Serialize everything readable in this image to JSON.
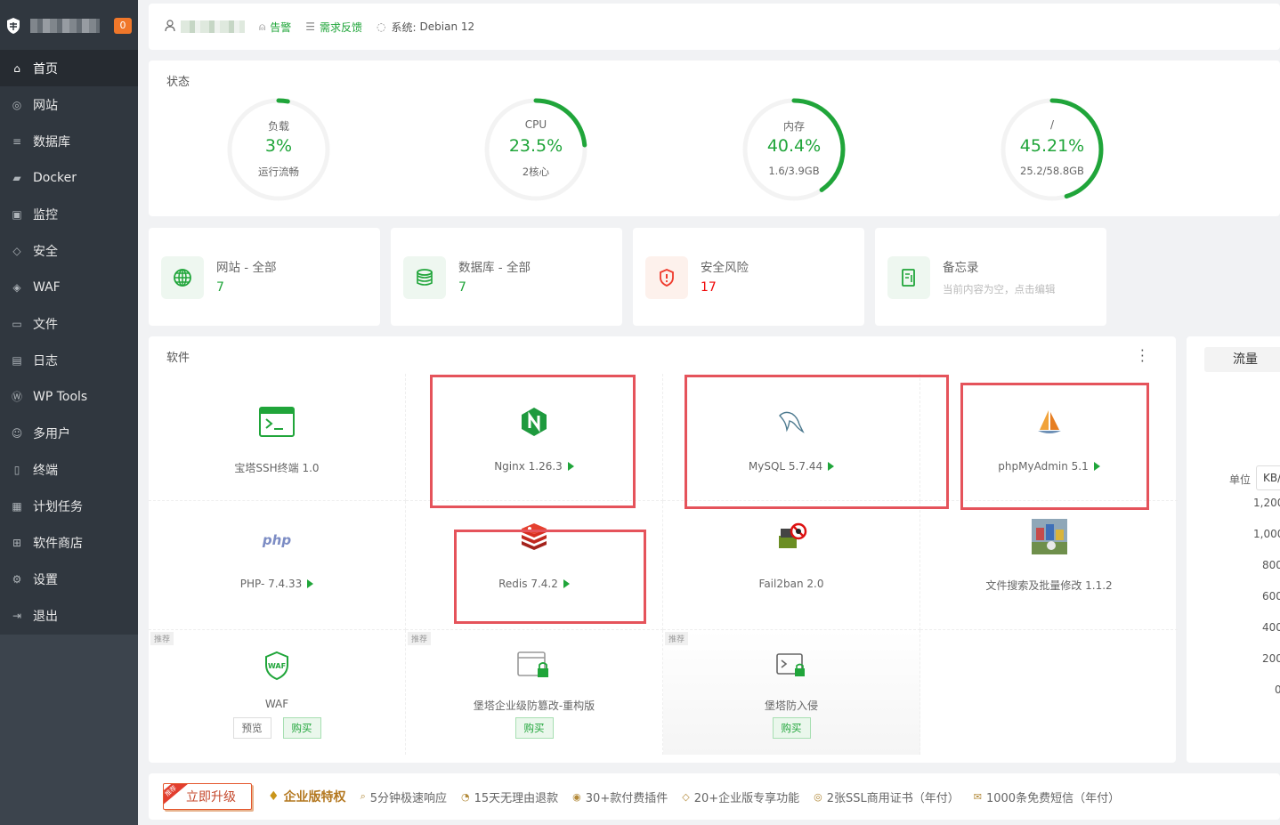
{
  "sidebar": {
    "badge": "0",
    "items": [
      {
        "label": "首页",
        "icon": "home-icon",
        "active": true
      },
      {
        "label": "网站",
        "icon": "globe-icon"
      },
      {
        "label": "数据库",
        "icon": "database-icon"
      },
      {
        "label": "Docker",
        "icon": "docker-icon"
      },
      {
        "label": "监控",
        "icon": "monitor-icon"
      },
      {
        "label": "安全",
        "icon": "shield-check-icon"
      },
      {
        "label": "WAF",
        "icon": "waf-shield-icon"
      },
      {
        "label": "文件",
        "icon": "folder-icon"
      },
      {
        "label": "日志",
        "icon": "log-icon"
      },
      {
        "label": "WP Tools",
        "icon": "wordpress-icon"
      },
      {
        "label": "多用户",
        "icon": "users-icon"
      },
      {
        "label": "终端",
        "icon": "terminal-icon"
      },
      {
        "label": "计划任务",
        "icon": "calendar-icon"
      },
      {
        "label": "软件商店",
        "icon": "store-icon"
      },
      {
        "label": "设置",
        "icon": "gear-icon"
      },
      {
        "label": "退出",
        "icon": "logout-icon"
      }
    ]
  },
  "topbar": {
    "alert_label": "告警",
    "feedback_label": "需求反馈",
    "system_label": "系统:",
    "system_value": "Debian 12"
  },
  "status": {
    "title": "状态",
    "gauges": [
      {
        "label": "负载",
        "value": "3%",
        "sub": "运行流畅",
        "percent": 3
      },
      {
        "label": "CPU",
        "value": "23.5%",
        "sub": "2核心",
        "percent": 23.5
      },
      {
        "label": "内存",
        "value": "40.4%",
        "sub": "1.6/3.9GB",
        "percent": 40.4
      },
      {
        "label": "/",
        "value": "45.21%",
        "sub": "25.2/58.8GB",
        "percent": 45.21
      }
    ]
  },
  "cards": [
    {
      "title": "网站 - 全部",
      "value": "7"
    },
    {
      "title": "数据库 - 全部",
      "value": "7"
    },
    {
      "title": "安全风险",
      "value": "17"
    },
    {
      "title": "备忘录",
      "value": "当前内容为空，点击编辑"
    }
  ],
  "software": {
    "title": "软件",
    "items": [
      {
        "name": "宝塔SSH终端 1.0"
      },
      {
        "name": "Nginx 1.26.3"
      },
      {
        "name": "MySQL 5.7.44"
      },
      {
        "name": "phpMyAdmin 5.1"
      },
      {
        "name": "PHP- 7.4.33"
      },
      {
        "name": "Redis 7.4.2"
      },
      {
        "name": "Fail2ban 2.0"
      },
      {
        "name": "文件搜索及批量修改 1.1.2"
      }
    ],
    "recommended": [
      {
        "tag": "推荐",
        "name": "WAF",
        "preview": "预览",
        "buy": "购买"
      },
      {
        "tag": "推荐",
        "name": "堡塔企业级防篡改-重构版",
        "buy": "购买"
      },
      {
        "tag": "推荐",
        "name": "堡塔防入侵",
        "buy": "购买"
      }
    ]
  },
  "traffic": {
    "tab_label": "流量",
    "unit_label": "单位",
    "unit_value": "KB/",
    "ticks": [
      "1,200",
      "1,000",
      "800",
      "600",
      "400",
      "200",
      "0"
    ]
  },
  "bottom": {
    "corner_tag": "推荐",
    "upgrade": "立即升级",
    "enterprise": "企业版特权",
    "features": [
      "5分钟极速响应",
      "15天无理由退款",
      "30+款付费插件",
      "20+企业版专享功能",
      "2张SSL商用证书（年付）",
      "1000条免费短信（年付）"
    ]
  },
  "colors": {
    "accent": "#20a53a",
    "danger": "#ef0808",
    "highlight": "#e5535b",
    "sidebar": "#30373f"
  }
}
